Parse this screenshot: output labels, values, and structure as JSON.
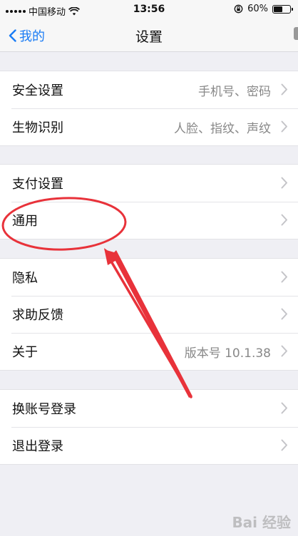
{
  "status_bar": {
    "carrier": "中国移动",
    "time": "13:56",
    "battery": "60%",
    "battery_level": 0.6
  },
  "nav": {
    "back_label": "我的",
    "title": "设置"
  },
  "groups": [
    {
      "rows": [
        {
          "label": "安全设置",
          "value": "手机号、密码"
        },
        {
          "label": "生物识别",
          "value": "人脸、指纹、声纹"
        }
      ]
    },
    {
      "rows": [
        {
          "label": "支付设置",
          "value": ""
        },
        {
          "label": "通用",
          "value": ""
        }
      ]
    },
    {
      "rows": [
        {
          "label": "隐私",
          "value": ""
        },
        {
          "label": "求助反馈",
          "value": ""
        },
        {
          "label": "关于",
          "value": "版本号 10.1.38"
        }
      ]
    },
    {
      "rows": [
        {
          "label": "换账号登录",
          "value": ""
        },
        {
          "label": "退出登录",
          "value": ""
        }
      ]
    }
  ],
  "annotation_color": "#e8323a",
  "accent_color": "#1a7cf5",
  "watermark": "Bai 经验"
}
